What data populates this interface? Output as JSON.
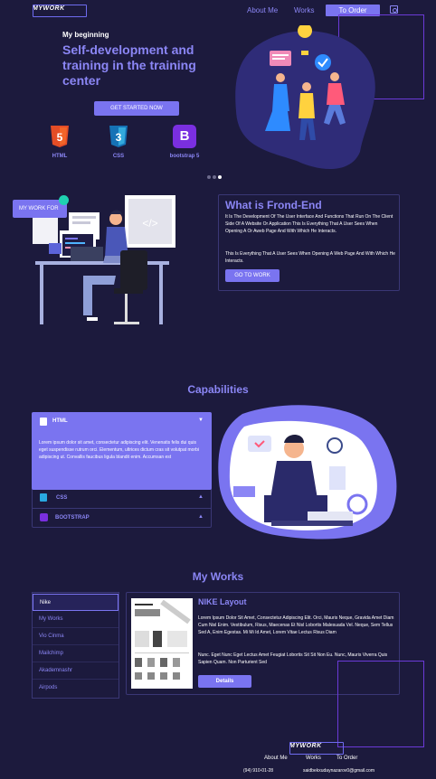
{
  "nav": {
    "logo": "MYWORK",
    "links": [
      "About Me",
      "Works"
    ],
    "cta": "To Order"
  },
  "hero": {
    "kicker": "My beginning",
    "title": "Self-development and training in the training center",
    "button": "GET STARTED NOW",
    "techs": [
      {
        "label": "HTML",
        "badge": "5",
        "color": "#e44d26"
      },
      {
        "label": "CSS",
        "badge": "3",
        "color": "#29a8e0"
      },
      {
        "label": "bootstrap 5",
        "badge": "B",
        "color": "#7a2fe0"
      }
    ]
  },
  "about": {
    "tag": "MY WORK FOR",
    "screen_glyph": "</>",
    "title": "What is Frond-End",
    "p1": "It Is The Development Of The User Interface And Functions That Run On The Client Side Of A Website Or Application This Is Everything That A User Sees When Opening A Or Aweb Page And With Which He Interacts.",
    "p2": "This Is Everything That A User Sees When Opening A Web Page And With Which He Interacts.",
    "button": "GO TO WORK"
  },
  "capabilities": {
    "title": "Capabilities",
    "items": [
      {
        "label": "HTML",
        "open": true,
        "text": "Lorem ipsum dolor sit amet, consectetur adipiscing elit. Venenatis felis dui quis eget suspendisse rutrum orci. Elementum, ultrices dictum cras sit volutpat morbi adipiscing ut. Convallis faucibus ligula blandit enim. Accumsan est"
      },
      {
        "label": "CSS",
        "open": false
      },
      {
        "label": "BOOTSTRAP",
        "open": false
      }
    ]
  },
  "works": {
    "title": "My Works",
    "list": [
      "Nike",
      "My Works",
      "Vio Cinma",
      "Mailchimp",
      "Akademnashr",
      "Airpods"
    ],
    "selected": "Nike",
    "card": {
      "title": "NIKE Layout",
      "p1": "Lorem Ipsum Dolor Sit Amet, Consectetur Adipiscing Elit. Orci, Mauris Neque, Gravida Amet Diam Cum Nisl Enim. Vestibulum, Risus, Maecenas Et Nisl Lobortis Malesuada Vel. Neque, Sem Tellus Sed A, Enim Egestas. Mi Mi Id Amet, Lorem Vitae Lectus Risus Diam",
      "p2": "Nunc. Eget Nunc Eget Lectus Amet Feugiat Lobortis Sit Sit Non Eu. Nunc, Mauris Viverra Quis Sapien Quam. Non Parturient Sed",
      "button": "Details"
    }
  },
  "footer": {
    "logo": "MYWORK",
    "links": [
      "About Me",
      "Works",
      "To Order"
    ],
    "phone": "(94) 910-01-28",
    "email": "saidbekxudaynazarov0@gmail.com"
  },
  "colors": {
    "bg": "#1c1a3d",
    "accent": "#7a74f0",
    "accent_text": "#8b86f5",
    "outline": "#6b3ad8"
  }
}
